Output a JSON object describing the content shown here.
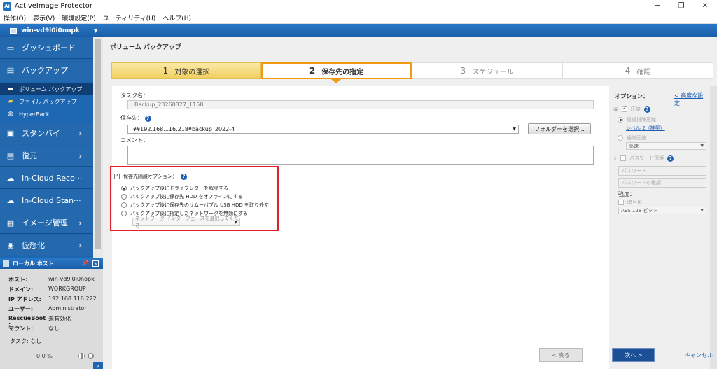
{
  "window": {
    "title": "ActiveImage Protector",
    "app_icon": "Ai",
    "minimize": "─",
    "restore": "❐",
    "close": "✕"
  },
  "menu": [
    "操作(O)",
    "表示(V)",
    "環境設定(P)",
    "ユーティリティ(U)",
    "ヘルプ(H)"
  ],
  "host_bar": {
    "name": "win-vd9l0i0nopk",
    "caret": "▼"
  },
  "sidebar": {
    "items": [
      {
        "label": "ダッシュボード",
        "icon": "monitor-icon",
        "glyph": "▭"
      },
      {
        "label": "バックアップ",
        "icon": "backup-icon",
        "glyph": "▤"
      },
      {
        "label": "スタンバイ",
        "icon": "standby-icon",
        "glyph": "▣",
        "arrow": "›"
      },
      {
        "label": "復元",
        "icon": "restore-icon",
        "glyph": "▤",
        "arrow": "›"
      },
      {
        "label": "In-Cloud Reco···",
        "icon": "cloud-icon",
        "glyph": "☁"
      },
      {
        "label": "In-Cloud Stan···",
        "icon": "cloud-icon",
        "glyph": "☁"
      },
      {
        "label": "イメージ管理",
        "icon": "image-manage-icon",
        "glyph": "▦",
        "arrow": "›"
      },
      {
        "label": "仮想化",
        "icon": "virtualize-icon",
        "glyph": "◉",
        "arrow": "›"
      }
    ],
    "backup_sub": [
      {
        "label": "ボリューム バックアップ",
        "icon": "volume-icon",
        "glyph": "▬"
      },
      {
        "label": "ファイル バックアップ",
        "icon": "folder-icon",
        "glyph": "▰"
      },
      {
        "label": "HyperBack",
        "icon": "hyperback-icon",
        "glyph": "◍"
      }
    ]
  },
  "local_host": {
    "title": "ローカル ホスト",
    "pin": "📌",
    "close": "×",
    "rows": [
      {
        "k": "ホスト:",
        "v": "win-vd9l0i0nopk"
      },
      {
        "k": "ドメイン:",
        "v": "WORKGROUP"
      },
      {
        "k": "IP アドレス:",
        "v": "192.168.116.222"
      },
      {
        "k": "ユーザー:",
        "v": "Administrator"
      },
      {
        "k": "RescueBoot :",
        "v": "未有効化"
      },
      {
        "k": "マウント:",
        "v": "なし"
      }
    ],
    "task_label": "タスク: なし",
    "progress": "0.0 %",
    "collapse": "«"
  },
  "main": {
    "title": "ボリューム バックアップ",
    "steps": [
      {
        "num": "1",
        "label": "対象の選択"
      },
      {
        "num": "2",
        "label": "保存先の指定"
      },
      {
        "num": "3",
        "label": "スケジュール"
      },
      {
        "num": "4",
        "label": "確認"
      }
    ],
    "task_name_label": "タスク名：",
    "task_name_value": "Backup_20260327_1158",
    "dest_label": "保存先：",
    "dest_value": "¥¥192.168.116.218¥backup_2022-4",
    "browse_button": "フォルダーを選択...",
    "comment_label": "コメント：",
    "isolation_label": "保存先隔離オプション：",
    "isolation_options": [
      "バックアップ後にドライブレターを解除する",
      "バックアップ後に保存先 HDD をオフラインにする",
      "バックアップ後に保存先のリムーバブル USB HDD を取り外す",
      "バックアップ後に指定したネットワークを無効にする"
    ],
    "network_placeholder": "ネットワーク インターフェースを選択してくださ"
  },
  "options": {
    "title": "オプション：",
    "advanced_link": "< 高度な設定",
    "compress_label": "圧縮",
    "dedupe_label": "重複排除圧縮",
    "dedupe_level": "レベル 2（推奨）",
    "normal_label": "通常圧縮",
    "speed_value": "高速",
    "password_label": "パスワード保護",
    "password_placeholder": "パスワード",
    "password_confirm_placeholder": "パスワードの確認",
    "strength_label": "強度：",
    "encrypt_label": "暗号化",
    "encrypt_value": "AES 128 ビット"
  },
  "footer": {
    "back": "< 戻る",
    "next": "次へ >",
    "cancel": "キャンセル"
  }
}
